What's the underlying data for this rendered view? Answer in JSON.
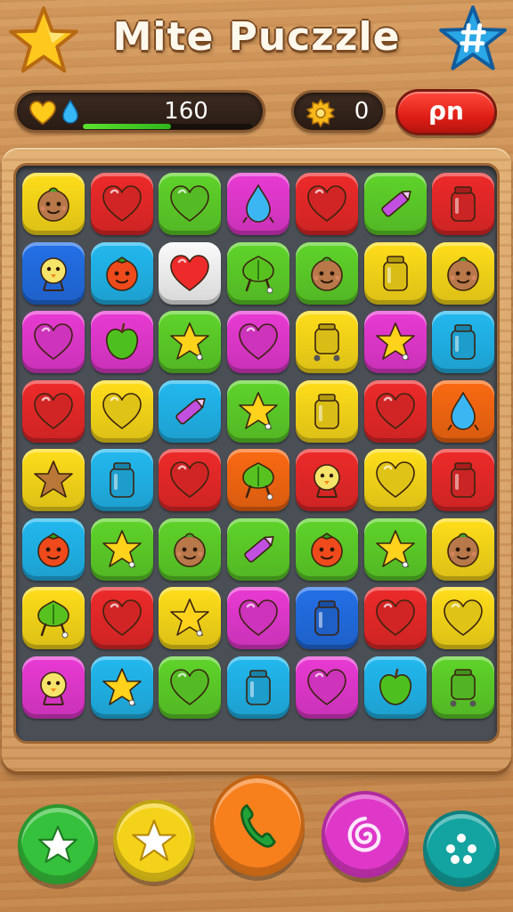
{
  "header": {
    "title": "Mite Puczzle"
  },
  "status": {
    "score": "160",
    "progress": 0.52,
    "coins": "0",
    "button_label": "ρn"
  },
  "colors": {
    "red": "#ee2a2a",
    "green": "#5fd42a",
    "yellow": "#ffde1a",
    "magenta": "#e93ad4",
    "blue": "#22b9f0",
    "orange": "#fb6a12",
    "white": "#fafafa",
    "navy": "#2370e8"
  },
  "board": {
    "rows": [
      [
        {
          "color": "yellow",
          "icon": "coconut-face"
        },
        {
          "color": "red",
          "icon": "heart"
        },
        {
          "color": "green",
          "icon": "heart"
        },
        {
          "color": "magenta",
          "icon": "droplet"
        },
        {
          "color": "red",
          "icon": "heart"
        },
        {
          "color": "green",
          "icon": "crayon"
        },
        {
          "color": "red",
          "icon": "jar"
        }
      ],
      [
        {
          "color": "navy",
          "icon": "chick"
        },
        {
          "color": "blue",
          "icon": "tomato-face"
        },
        {
          "color": "white",
          "icon": "heart"
        },
        {
          "color": "green",
          "icon": "leaf-bug"
        },
        {
          "color": "green",
          "icon": "coconut-face"
        },
        {
          "color": "yellow",
          "icon": "jar"
        },
        {
          "color": "yellow",
          "icon": "coconut-face"
        }
      ],
      [
        {
          "color": "magenta",
          "icon": "heart"
        },
        {
          "color": "magenta",
          "icon": "apple"
        },
        {
          "color": "green",
          "icon": "star"
        },
        {
          "color": "magenta",
          "icon": "heart"
        },
        {
          "color": "yellow",
          "icon": "jar-cart"
        },
        {
          "color": "magenta",
          "icon": "star"
        },
        {
          "color": "blue",
          "icon": "jar"
        }
      ],
      [
        {
          "color": "red",
          "icon": "heart"
        },
        {
          "color": "yellow",
          "icon": "heart"
        },
        {
          "color": "blue",
          "icon": "crayon"
        },
        {
          "color": "green",
          "icon": "star"
        },
        {
          "color": "yellow",
          "icon": "jar"
        },
        {
          "color": "red",
          "icon": "heart"
        },
        {
          "color": "orange",
          "icon": "droplet"
        }
      ],
      [
        {
          "color": "yellow",
          "icon": "cookie-star"
        },
        {
          "color": "blue",
          "icon": "jar"
        },
        {
          "color": "red",
          "icon": "heart"
        },
        {
          "color": "orange",
          "icon": "leaf-bug"
        },
        {
          "color": "red",
          "icon": "chick"
        },
        {
          "color": "yellow",
          "icon": "heart"
        },
        {
          "color": "red",
          "icon": "jar"
        }
      ],
      [
        {
          "color": "blue",
          "icon": "tomato-face"
        },
        {
          "color": "green",
          "icon": "star"
        },
        {
          "color": "green",
          "icon": "coconut-face"
        },
        {
          "color": "green",
          "icon": "crayon"
        },
        {
          "color": "green",
          "icon": "tomato-face"
        },
        {
          "color": "green",
          "icon": "star"
        },
        {
          "color": "yellow",
          "icon": "coconut-face"
        }
      ],
      [
        {
          "color": "yellow",
          "icon": "leaf-bug"
        },
        {
          "color": "red",
          "icon": "heart"
        },
        {
          "color": "yellow",
          "icon": "star"
        },
        {
          "color": "magenta",
          "icon": "heart"
        },
        {
          "color": "navy",
          "icon": "jar"
        },
        {
          "color": "red",
          "icon": "heart"
        },
        {
          "color": "yellow",
          "icon": "heart"
        }
      ],
      [
        {
          "color": "magenta",
          "icon": "chick"
        },
        {
          "color": "blue",
          "icon": "star"
        },
        {
          "color": "green",
          "icon": "heart"
        },
        {
          "color": "blue",
          "icon": "jar"
        },
        {
          "color": "magenta",
          "icon": "heart"
        },
        {
          "color": "blue",
          "icon": "apple"
        },
        {
          "color": "green",
          "icon": "jar-cart"
        }
      ]
    ]
  },
  "powerups": [
    {
      "name": "hint-powerup-button",
      "color": "#35c13b",
      "icon": "star-arrow-icon"
    },
    {
      "name": "star-powerup-button",
      "color": "#f5d21a",
      "icon": "star-icon"
    },
    {
      "name": "phone-powerup-button",
      "color": "#f7801d",
      "icon": "phone-icon"
    },
    {
      "name": "swirl-powerup-button",
      "color": "#df38c9",
      "icon": "swirl-icon"
    },
    {
      "name": "menu-dots-button",
      "color": "#13a3a0",
      "icon": "dots-icon"
    }
  ]
}
